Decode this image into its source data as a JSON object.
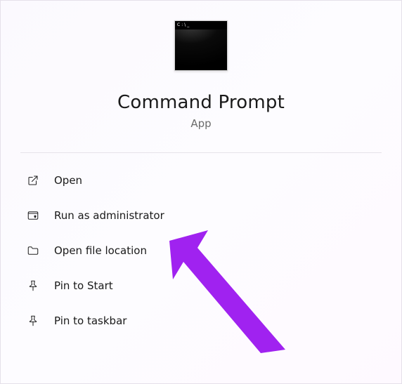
{
  "header": {
    "title": "Command Prompt",
    "subtitle": "App",
    "icon_prompt": "C:\\_"
  },
  "menu": {
    "items": [
      {
        "label": "Open"
      },
      {
        "label": "Run as administrator"
      },
      {
        "label": "Open file location"
      },
      {
        "label": "Pin to Start"
      },
      {
        "label": "Pin to taskbar"
      }
    ]
  },
  "annotation": {
    "arrow_color": "#a020f0"
  }
}
